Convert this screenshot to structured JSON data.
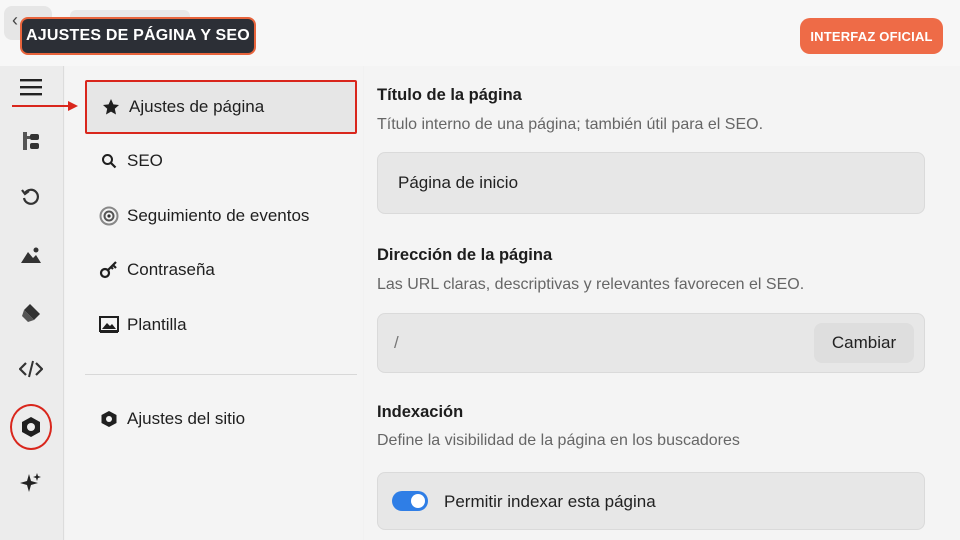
{
  "header": {
    "badge": "AJUSTES DE PÁGINA Y SEO",
    "official_button": "INTERFAZ OFICIAL"
  },
  "rail": {
    "icons": [
      "menu-icon",
      "layers-icon",
      "history-icon",
      "image-icon",
      "brush-icon",
      "code-icon",
      "settings-hex-icon",
      "sparkle-icon"
    ],
    "active": "settings-hex-icon"
  },
  "subnav": {
    "items": [
      {
        "label": "Ajustes de página",
        "icon": "star-icon"
      },
      {
        "label": "SEO",
        "icon": "search-icon"
      },
      {
        "label": "Seguimiento de eventos",
        "icon": "target-icon"
      },
      {
        "label": "Contraseña",
        "icon": "key-icon"
      },
      {
        "label": "Plantilla",
        "icon": "template-icon"
      }
    ],
    "site_settings": {
      "label": "Ajustes del sitio",
      "icon": "hexagon-icon"
    },
    "active_index": 0
  },
  "main": {
    "title_section": {
      "heading": "Título de la página",
      "description": "Título interno de una página; también útil para el SEO.",
      "value": "Página de inicio"
    },
    "address_section": {
      "heading": "Dirección de la página",
      "description": "Las URL claras, descriptivas y relevantes favorecen el SEO.",
      "slug": "/",
      "change_button": "Cambiar"
    },
    "indexing_section": {
      "heading": "Indexación",
      "description": "Define la visibilidad de la página en los buscadores",
      "toggle_label": "Permitir indexar esta página",
      "toggle_on": true
    }
  },
  "colors": {
    "accent_red": "#d9261c",
    "official_orange": "#ee6b47",
    "toggle_blue": "#2f7ee6",
    "badge_dark": "#2c2f36"
  }
}
